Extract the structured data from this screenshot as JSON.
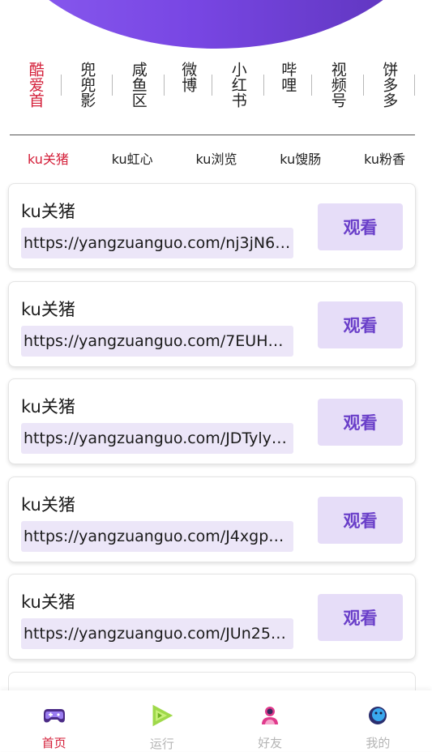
{
  "categories": [
    {
      "label": "酷爱首",
      "active": true
    },
    {
      "label": "兜兜影",
      "active": false
    },
    {
      "label": "咸鱼区",
      "active": false
    },
    {
      "label": "微博",
      "active": false
    },
    {
      "label": "小红书",
      "active": false
    },
    {
      "label": "哔哩",
      "active": false
    },
    {
      "label": "视频号",
      "active": false
    },
    {
      "label": "饼多多",
      "active": false
    }
  ],
  "subtabs": [
    {
      "label": "ku关猪",
      "active": true
    },
    {
      "label": "ku虹心",
      "active": false
    },
    {
      "label": "ku浏览",
      "active": false
    },
    {
      "label": "ku馊肠",
      "active": false
    },
    {
      "label": "ku粉香",
      "active": false
    }
  ],
  "cards": [
    {
      "title": "ku关猪",
      "url": "https://yangzuanguo.com/nj3jN6…",
      "button": "观看"
    },
    {
      "title": "ku关猪",
      "url": "https://yangzuanguo.com/7EUH…",
      "button": "观看"
    },
    {
      "title": "ku关猪",
      "url": "https://yangzuanguo.com/JDTyly…",
      "button": "观看"
    },
    {
      "title": "ku关猪",
      "url": "https://yangzuanguo.com/J4xgp…",
      "button": "观看"
    },
    {
      "title": "ku关猪",
      "url": "https://yangzuanguo.com/JUn25…",
      "button": "观看"
    }
  ],
  "nav": [
    {
      "label": "首页",
      "icon": "gamepad-icon",
      "active": true
    },
    {
      "label": "运行",
      "icon": "play-icon",
      "active": false
    },
    {
      "label": "好友",
      "icon": "friend-icon",
      "active": false
    },
    {
      "label": "我的",
      "icon": "profile-icon",
      "active": false
    }
  ],
  "colors": {
    "accent": "#d4203a",
    "brand": "#7846e3",
    "button_bg": "#e6ddf8",
    "url_bg": "#ece6f8"
  }
}
